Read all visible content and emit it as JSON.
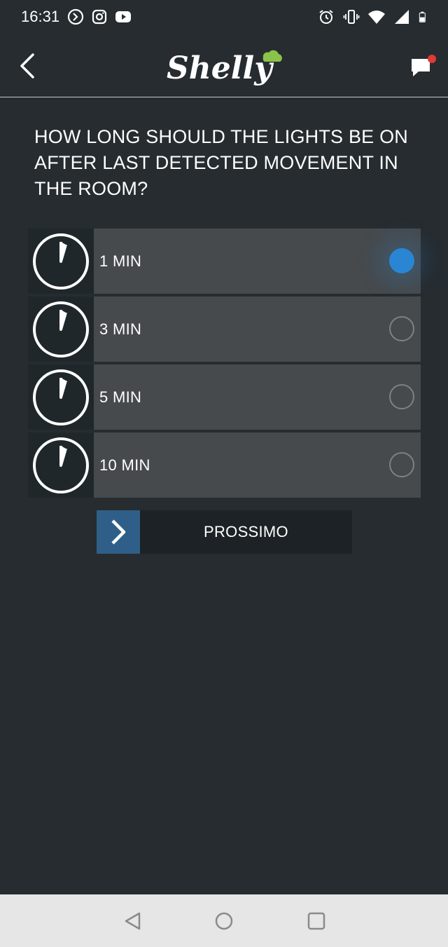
{
  "status_bar": {
    "time": "16:31",
    "left_icons": [
      "sync-icon",
      "instagram-icon",
      "youtube-icon"
    ],
    "right_icons": [
      "alarm-icon",
      "vibrate-icon",
      "wifi-icon",
      "signal-icon",
      "battery-icon"
    ]
  },
  "app_bar": {
    "logo_text": "Shelly",
    "back_icon": "chevron-left-icon",
    "chat_icon": "chat-bubble-icon",
    "notification_dot_color": "#e53935"
  },
  "question": "HOW LONG SHOULD THE LIGHTS BE ON AFTER LAST DETECTED MOVEMENT IN THE ROOM?",
  "options": [
    {
      "label": "1 MIN",
      "selected": true
    },
    {
      "label": "3 MIN",
      "selected": false
    },
    {
      "label": "5 MIN",
      "selected": false
    },
    {
      "label": "10 MIN",
      "selected": false
    }
  ],
  "next_button": {
    "label": "PROSSIMO",
    "icon": "chevron-right-icon"
  },
  "nav_bar": {
    "buttons": [
      "back-triangle-icon",
      "home-circle-icon",
      "recents-square-icon"
    ]
  },
  "colors": {
    "background": "#262c30",
    "accent": "#2a86d3",
    "option_bg": "#464a4d",
    "logo_cloud": "#8bc34a"
  }
}
